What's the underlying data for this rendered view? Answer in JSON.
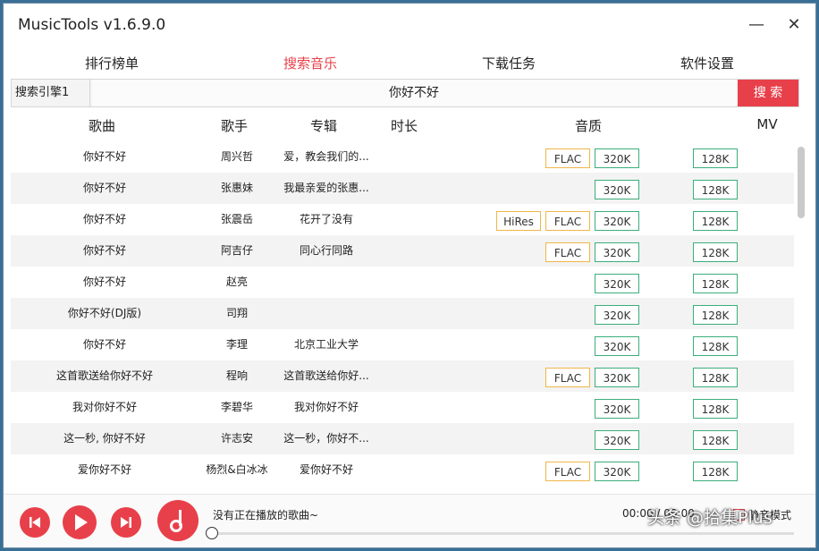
{
  "window": {
    "title": "MusicTools v1.6.9.0",
    "minimize": "—",
    "close": "✕"
  },
  "tabs": [
    {
      "label": "排行榜单"
    },
    {
      "label": "搜索音乐"
    },
    {
      "label": "下载任务"
    },
    {
      "label": "软件设置"
    }
  ],
  "search": {
    "engine": "搜索引擎1",
    "query": "你好不好",
    "button": "搜 索"
  },
  "columns": {
    "song": "歌曲",
    "singer": "歌手",
    "album": "专辑",
    "duration": "时长",
    "quality": "音质",
    "mv": "MV"
  },
  "rows": [
    {
      "song": "你好不好",
      "singer": "周兴哲",
      "album": "爱，教会我们的...",
      "hires": "",
      "flac": "FLAC",
      "q320": "320K",
      "q128": "128K"
    },
    {
      "song": "你好不好",
      "singer": "张惠妹",
      "album": "我最亲爱的张惠...",
      "hires": "",
      "flac": "",
      "q320": "320K",
      "q128": "128K"
    },
    {
      "song": "你好不好",
      "singer": "张震岳",
      "album": "花开了没有",
      "hires": "HiRes",
      "flac": "FLAC",
      "q320": "320K",
      "q128": "128K"
    },
    {
      "song": "你好不好",
      "singer": "阿吉仔",
      "album": "同心行同路",
      "hires": "",
      "flac": "FLAC",
      "q320": "320K",
      "q128": "128K"
    },
    {
      "song": "你好不好",
      "singer": "赵亮",
      "album": "",
      "hires": "",
      "flac": "",
      "q320": "320K",
      "q128": "128K"
    },
    {
      "song": "你好不好(DJ版)",
      "singer": "司翔",
      "album": "",
      "hires": "",
      "flac": "",
      "q320": "320K",
      "q128": "128K"
    },
    {
      "song": "你好不好",
      "singer": "李理",
      "album": "北京工业大学",
      "hires": "",
      "flac": "",
      "q320": "320K",
      "q128": "128K"
    },
    {
      "song": "这首歌送给你好不好",
      "singer": "程响",
      "album": "这首歌送给你好...",
      "hires": "",
      "flac": "FLAC",
      "q320": "320K",
      "q128": "128K"
    },
    {
      "song": "我对你好不好",
      "singer": "李碧华",
      "album": "我对你好不好",
      "hires": "",
      "flac": "",
      "q320": "320K",
      "q128": "128K"
    },
    {
      "song": "这一秒, 你好不好",
      "singer": "许志安",
      "album": "这一秒，你好不...",
      "hires": "",
      "flac": "",
      "q320": "320K",
      "q128": "128K"
    },
    {
      "song": "爱你好不好",
      "singer": "杨烈&白冰冰",
      "album": "爱你好不好",
      "hires": "",
      "flac": "FLAC",
      "q320": "320K",
      "q128": "128K"
    }
  ],
  "player": {
    "now_playing": "没有正在播放的歌曲~",
    "time": "00:00 / 00:00",
    "mute_label": "静音模式",
    "progress": 0
  },
  "watermark": "头条 @拾集Plus",
  "colors": {
    "accent": "#e8404a",
    "flac_border": "#f0b64a",
    "bitrate_border": "#3cae7a"
  },
  "icons": {
    "prev": "skip-previous-icon",
    "play": "play-icon",
    "next": "skip-next-icon",
    "music": "music-note-icon"
  }
}
